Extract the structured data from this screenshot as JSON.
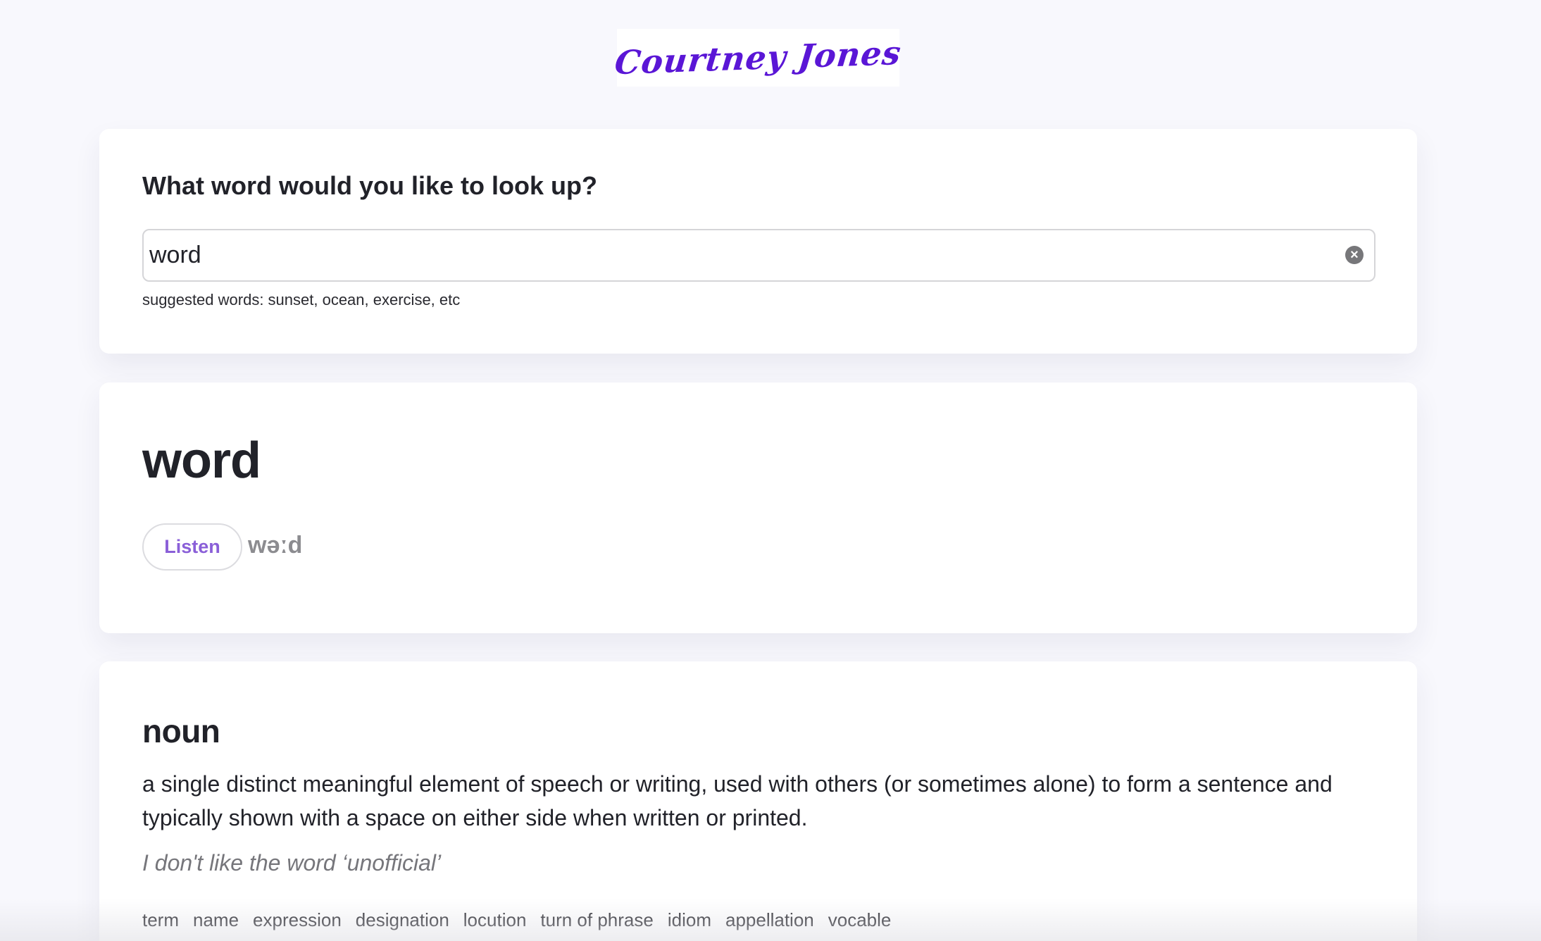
{
  "header": {
    "logo_text": "Courtney Jones"
  },
  "search": {
    "question": "What word would you like to look up?",
    "value": "word",
    "hint": "suggested words: sunset, ocean, exercise, etc",
    "clear_icon": "close-circle-icon"
  },
  "result": {
    "word": "word",
    "listen_label": "Listen",
    "phonetic": "wəːd"
  },
  "meaning": {
    "part_of_speech": "noun",
    "definition": "a single distinct meaningful element of speech or writing, used with others (or sometimes alone) to form a sentence and typically shown with a space on either side when written or printed.",
    "example": "I don't like the word ‘unofficial’",
    "synonyms": [
      "term",
      "name",
      "expression",
      "designation",
      "locution",
      "turn of phrase",
      "idiom",
      "appellation",
      "vocable"
    ]
  },
  "colors": {
    "brand": "#5a16d6",
    "accent": "#8a5fd8",
    "background": "#f8f8fd"
  }
}
